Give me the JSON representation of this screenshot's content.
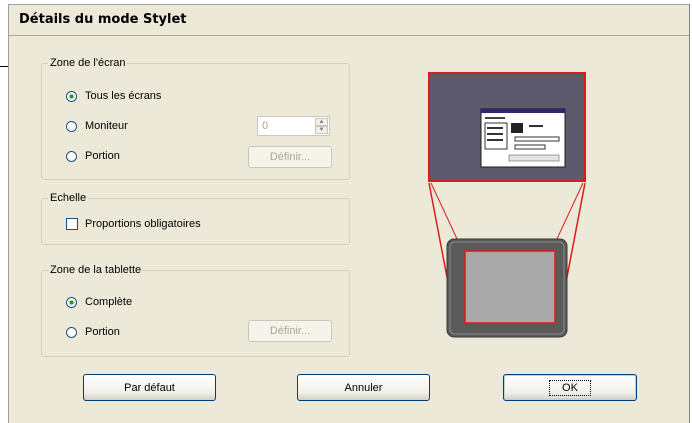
{
  "window": {
    "title": "Détails du mode Stylet"
  },
  "screen_area": {
    "legend": "Zone de l'écran",
    "option_all": "Tous les écrans",
    "option_monitor": "Moniteur",
    "option_portion": "Portion",
    "monitor_value": "0",
    "define_label": "Définir..."
  },
  "scale": {
    "legend": "Echelle",
    "force_proportions": "Proportions obligatoires"
  },
  "tablet_area": {
    "legend": "Zone de la tablette",
    "option_full": "Complète",
    "option_portion": "Portion",
    "define_label": "Définir..."
  },
  "buttons": {
    "default": "Par défaut",
    "cancel": "Annuler",
    "ok": "OK"
  }
}
